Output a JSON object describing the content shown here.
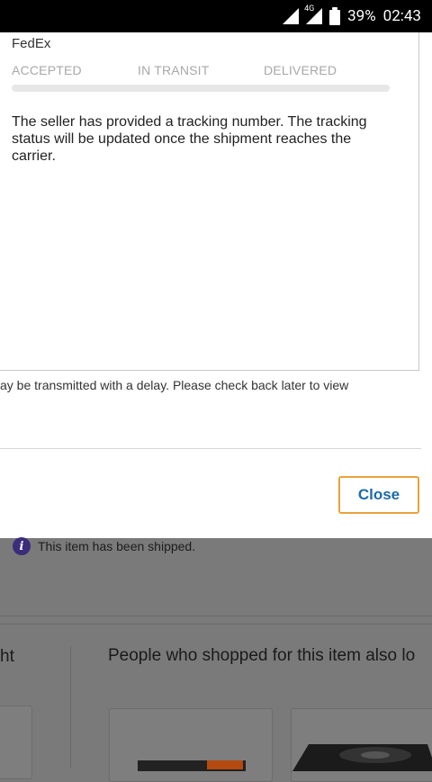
{
  "status_bar": {
    "network": "4G",
    "battery": "39%",
    "time": "02:43"
  },
  "tracking": {
    "carrier": "FedEx",
    "steps": [
      "ACCEPTED",
      "IN TRANSIT",
      "DELIVERED"
    ],
    "progress": 0,
    "message": "The seller has provided a tracking number. The tracking status will be updated once the shipment reaches the carrier."
  },
  "note": "ay be transmitted with a delay. Please check back later to view",
  "close_label": "Close",
  "background": {
    "shipped_text": "This item has been shipped.",
    "left_fragment": "ht",
    "people_heading": "People who shopped for this item also lo"
  }
}
